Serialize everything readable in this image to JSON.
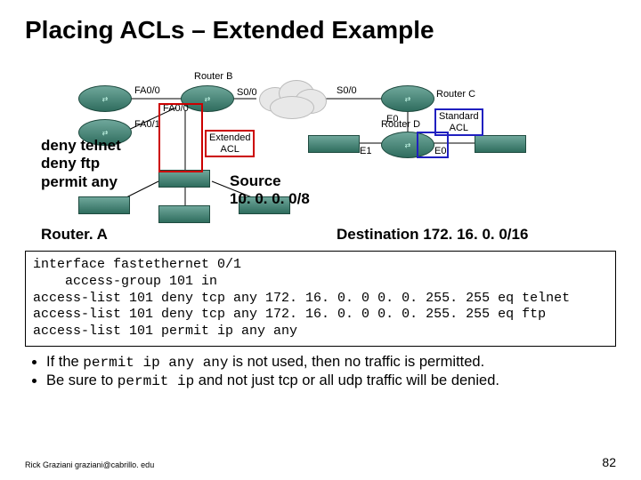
{
  "title": "Placing ACLs – Extended Example",
  "overlay": {
    "rules": {
      "line1": "deny telnet",
      "line2": "deny ftp",
      "line3": "permit any"
    },
    "source": {
      "l1": "Source",
      "l2": "10. 0. 0. 0/8"
    },
    "router": "Router. A",
    "dest": "Destination 172. 16. 0. 0/16"
  },
  "diagram": {
    "routerB": "Router B",
    "routerC": "Router C",
    "routerD": "Router D",
    "fa00_a": "FA0/0",
    "fa01_a": "FA0/1",
    "fa00_b": "FA0/0",
    "s00_b": "S0/0",
    "s00_c": "S0/0",
    "e0_c": "E0",
    "e1_d": "E1",
    "e0_d": "E0",
    "ext": {
      "l1": "Extended",
      "l2": "ACL"
    },
    "std": {
      "l1": "Standard",
      "l2": "ACL"
    }
  },
  "config": {
    "l1": "interface fastethernet 0/1",
    "l2": "    access-group 101 in",
    "l3": "access-list 101 deny tcp any 172. 16. 0. 0 0. 0. 255. 255 eq telnet",
    "l4": "access-list 101 deny tcp any 172. 16. 0. 0 0. 0. 255. 255 eq ftp",
    "l5": "access-list 101 permit ip any any"
  },
  "bullets": {
    "b1_pre": "If the ",
    "b1_code": "permit ip any any",
    "b1_post": " is not used, then no traffic is permitted.",
    "b2_pre": "Be sure to ",
    "b2_code": "permit ip",
    "b2_post": " and not just tcp or all udp traffic will be denied."
  },
  "footer": {
    "author": "Rick Graziani  graziani@cabrillo. edu",
    "page": "82"
  }
}
